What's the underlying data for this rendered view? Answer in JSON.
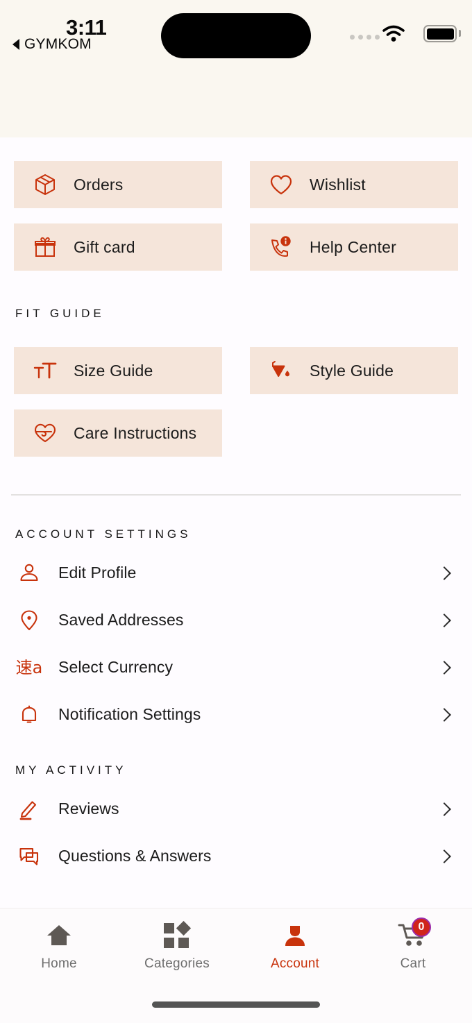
{
  "status_bar": {
    "time": "3:11",
    "back_app": "GYMKOM",
    "back_icon": "back-triangle-icon",
    "dynamic_island": "dynamic-island",
    "wifi_icon": "wifi-icon",
    "battery_icon": "battery-icon",
    "signal_dots_icon": "signal-dots-icon"
  },
  "quick_actions": [
    {
      "label": "Orders",
      "icon": "box-icon"
    },
    {
      "label": "Wishlist",
      "icon": "heart-icon"
    },
    {
      "label": "Gift card",
      "icon": "gift-icon"
    },
    {
      "label": "Help Center",
      "icon": "phone-info-icon"
    }
  ],
  "fit_guide": {
    "title": "FIT GUIDE",
    "items": [
      {
        "label": "Size Guide",
        "icon": "text-size-icon"
      },
      {
        "label": "Style Guide",
        "icon": "paint-bucket-icon"
      },
      {
        "label": "Care Instructions",
        "icon": "heart-wash-icon"
      }
    ]
  },
  "account_settings": {
    "title": "ACCOUNT SETTINGS",
    "items": [
      {
        "label": "Edit Profile",
        "icon": "user-icon"
      },
      {
        "label": "Saved Addresses",
        "icon": "location-pin-icon"
      },
      {
        "label": "Select Currency",
        "icon": "translate-icon",
        "glyph": "速a"
      },
      {
        "label": "Notification Settings",
        "icon": "bell-icon"
      }
    ]
  },
  "my_activity": {
    "title": "MY ACTIVITY",
    "items": [
      {
        "label": "Reviews",
        "icon": "pencil-icon"
      },
      {
        "label": "Questions & Answers",
        "icon": "chat-bubbles-icon"
      }
    ]
  },
  "tab_bar": {
    "items": [
      {
        "label": "Home",
        "icon": "home-icon",
        "active": false
      },
      {
        "label": "Categories",
        "icon": "categories-icon",
        "active": false
      },
      {
        "label": "Account",
        "icon": "person-icon",
        "active": true
      },
      {
        "label": "Cart",
        "icon": "cart-icon",
        "active": false,
        "badge": "0"
      }
    ]
  },
  "colors": {
    "accent": "#C8330C",
    "card_bg": "#F5E5DA",
    "status_bar_bg": "#FAF7F0",
    "page_bg": "#FEFCFF",
    "badge_red": "#D0241B",
    "tab_inactive": "#6E6E6E"
  }
}
